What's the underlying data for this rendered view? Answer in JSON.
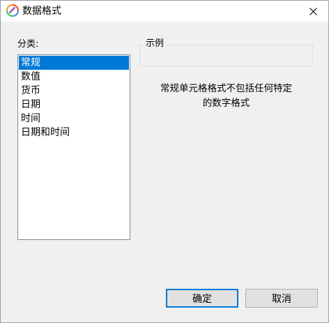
{
  "window": {
    "title": "数据格式",
    "app_icon": "colorful-ring-app-icon",
    "close_icon": "close-icon"
  },
  "category": {
    "label": "分类:",
    "selected": "常规",
    "items": [
      "常规",
      "数值",
      "货币",
      "日期",
      "时间",
      "日期和时间"
    ]
  },
  "sample": {
    "legend": "示例",
    "value": ""
  },
  "description": {
    "line1": "常规单元格格式不包括任何特定",
    "line2": "的数字格式"
  },
  "buttons": {
    "ok": "确定",
    "cancel": "取消"
  },
  "colors": {
    "selection": "#0078d7",
    "dialog_bg": "#f0f0f0",
    "default_button_border": "#0078d7"
  }
}
